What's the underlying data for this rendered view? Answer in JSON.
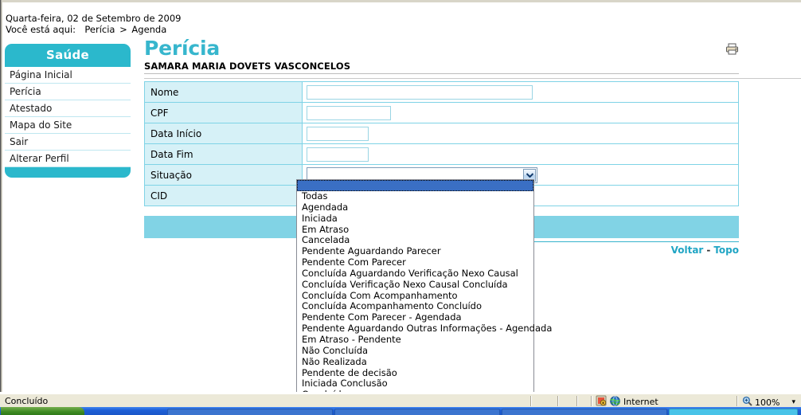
{
  "meta": {
    "date_line": "Quarta-feira, 02 de Setembro de 2009",
    "breadcrumb_prefix": "Você está aqui:",
    "breadcrumb_1": "Perícia",
    "breadcrumb_sep": ">",
    "breadcrumb_2": "Agenda"
  },
  "sidebar": {
    "header": "Saúde",
    "items": [
      {
        "label": "Página Inicial"
      },
      {
        "label": "Perícia"
      },
      {
        "label": "Atestado"
      },
      {
        "label": "Mapa do Site"
      },
      {
        "label": "Sair"
      },
      {
        "label": "Alterar Perfil"
      }
    ]
  },
  "main": {
    "title": "Perícia",
    "subject": "SAMARA MARIA DOVETS VASCONCELOS",
    "print_icon": "printer-icon"
  },
  "form": {
    "rows": [
      {
        "label": "Nome",
        "value": "",
        "placeholder": ""
      },
      {
        "label": "CPF",
        "value": "",
        "placeholder": ""
      },
      {
        "label": "Data Início",
        "value": "",
        "placeholder": ""
      },
      {
        "label": "Data Fim",
        "value": "",
        "placeholder": ""
      },
      {
        "label": "Situação",
        "value": "",
        "placeholder": ""
      },
      {
        "label": "CID",
        "value": "",
        "placeholder": ""
      }
    ],
    "situacao": {
      "selected": "",
      "expanded": true,
      "options": [
        "",
        "Todas",
        "Agendada",
        "Iniciada",
        "Em Atraso",
        "Cancelada",
        "Pendente Aguardando Parecer",
        "Pendente Com Parecer",
        "Concluída Aguardando Verificação Nexo Causal",
        "Concluída Verificação Nexo Causal Concluída",
        "Concluída Com Acompanhamento",
        "Concluída Acompanhamento Concluído",
        "Pendente Com Parecer - Agendada",
        "Pendente Aguardando Outras Informações - Agendada",
        "Em Atraso - Pendente",
        "Não Concluída",
        "Não Realizada",
        "Pendente de decisão",
        "Iniciada Conclusão",
        "Concluída"
      ]
    }
  },
  "footer_links": {
    "back": "Voltar",
    "separator": "-",
    "top": "Topo"
  },
  "statusbar": {
    "status": "Concluído",
    "zone_label": "Internet",
    "zone_icon": "globe-icon",
    "protected_icon": "shield-lock-icon",
    "zoom_icon": "magnifier-icon",
    "zoom_level": "100%",
    "zoom_caret": "▾"
  },
  "colors": {
    "accent_teal": "#2bb8cc",
    "title_teal": "#37b6cd",
    "label_cell": "#d6f1f7",
    "action_bar": "#81d3e5",
    "link_teal": "#20a5c4",
    "dropdown_select": "#3a6fc4"
  }
}
